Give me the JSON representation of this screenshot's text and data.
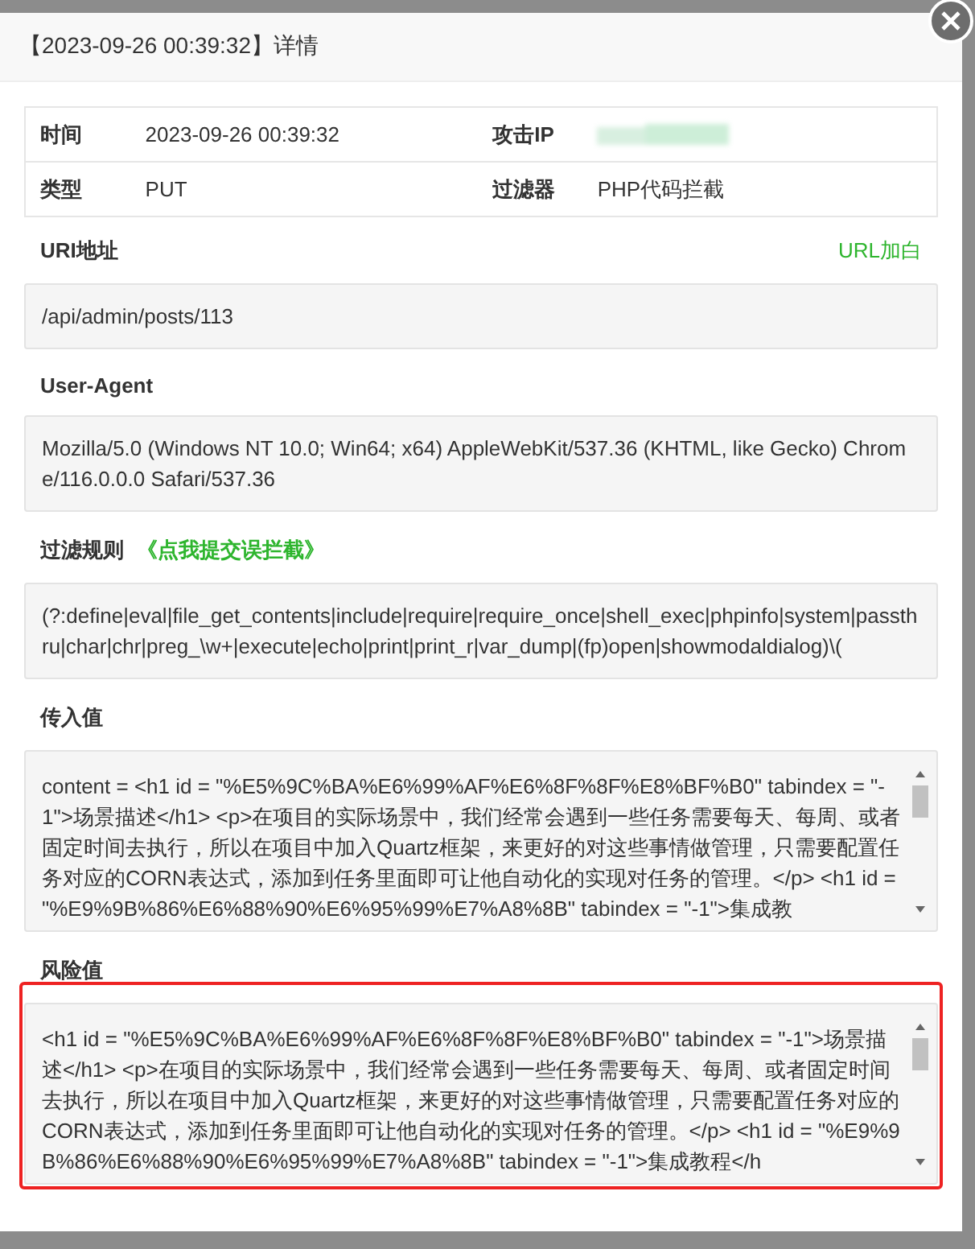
{
  "dialog": {
    "title": "【2023-09-26 00:39:32】详情"
  },
  "info_table": {
    "rows": [
      {
        "cells": [
          {
            "label": "时间",
            "kind": "text",
            "value": "2023-09-26 00:39:32"
          },
          {
            "label": "攻击IP",
            "kind": "blurred"
          }
        ]
      },
      {
        "cells": [
          {
            "label": "类型",
            "kind": "text",
            "value": "PUT"
          },
          {
            "label": "过滤器",
            "kind": "text",
            "value": "PHP代码拦截"
          }
        ]
      }
    ]
  },
  "sections": [
    {
      "heading": "URI地址",
      "action": "URL加白",
      "kind": "text",
      "highlighted": false,
      "value": "/api/admin/posts/113"
    },
    {
      "heading": "User-Agent",
      "kind": "text",
      "highlighted": false,
      "value": "Mozilla/5.0 (Windows NT 10.0; Win64; x64) AppleWebKit/537.36 (KHTML, like Gecko) Chrome/116.0.0.0 Safari/537.36"
    },
    {
      "heading": "过滤规则",
      "link": "《点我提交误拦截》",
      "kind": "text",
      "highlighted": false,
      "value": "(?:define|eval|file_get_contents|include|require|require_once|shell_exec|phpinfo|system|passthru|char|chr|preg_\\w+|execute|echo|print|print_r|var_dump|(fp)open|showmodaldialog)\\("
    },
    {
      "heading": "传入值",
      "kind": "scroll",
      "highlighted": false,
      "value": "content = <h1 id = \"%E5%9C%BA%E6%99%AF%E6%8F%8F%E8%BF%B0\" tabindex = \"-1\">场景描述</h1> <p>在项目的实际场景中，我们经常会遇到一些任务需要每天、每周、或者固定时间去执行，所以在项目中加入Quartz框架，来更好的对这些事情做管理，只需要配置任务对应的CORN表达式，添加到任务里面即可让他自动化的实现对任务的管理。</p> <h1 id = \"%E9%9B%86%E6%88%90%E6%95%99%E7%A8%8B\" tabindex = \"-1\">集成教"
    },
    {
      "heading": "风险值",
      "kind": "scroll",
      "highlighted": true,
      "value": "<h1 id = \"%E5%9C%BA%E6%99%AF%E6%8F%8F%E8%BF%B0\" tabindex = \"-1\">场景描述</h1> <p>在项目的实际场景中，我们经常会遇到一些任务需要每天、每周、或者固定时间去执行，所以在项目中加入Quartz框架，来更好的对这些事情做管理，只需要配置任务对应的CORN表达式，添加到任务里面即可让他自动化的实现对任务的管理。</p> <h1 id = \"%E9%9B%86%E6%88%90%E6%95%99%E7%A8%8B\" tabindex = \"-1\">集成教程</h"
    }
  ]
}
